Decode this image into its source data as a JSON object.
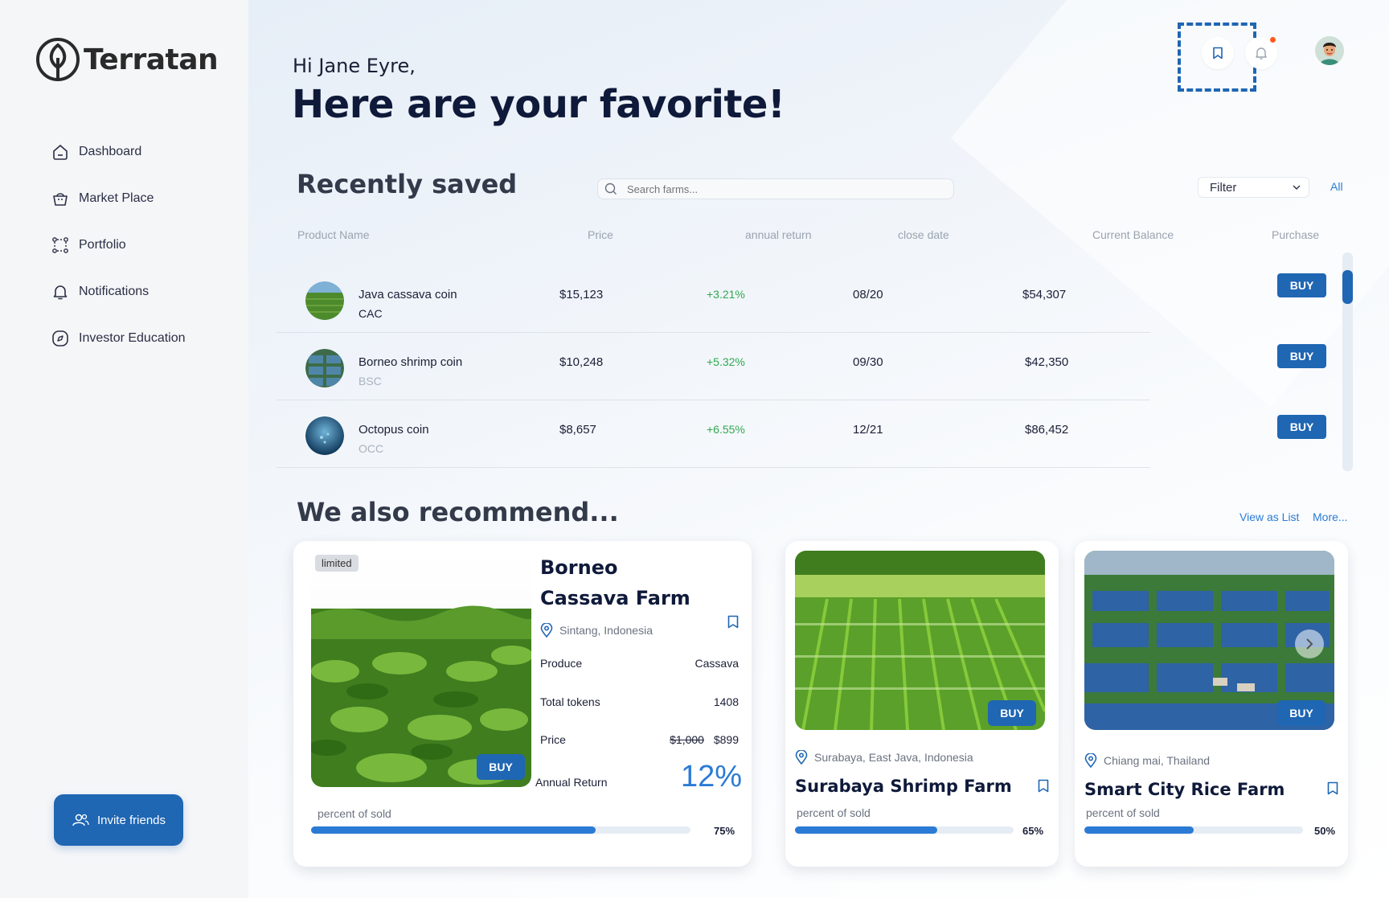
{
  "brand": {
    "name": "Terratan"
  },
  "sidebar": {
    "items": [
      {
        "label": "Dashboard",
        "icon": "home-icon"
      },
      {
        "label": "Market Place",
        "icon": "basket-icon"
      },
      {
        "label": "Portfolio",
        "icon": "portfolio-icon"
      },
      {
        "label": "Notifications",
        "icon": "bell-icon"
      },
      {
        "label": "Investor Education",
        "icon": "compass-icon"
      }
    ],
    "invite_label": "Invite friends"
  },
  "header": {
    "greeting": "Hi Jane Eyre,",
    "title": "Here are your favorite!"
  },
  "saved": {
    "title": "Recently saved",
    "search_placeholder": "Search farms...",
    "filter_label": "Filter",
    "all_label": "All",
    "columns": [
      "Product Name",
      "Price",
      "annual return",
      "close date",
      "Current Balance",
      "Purchase"
    ],
    "rows": [
      {
        "name": "Java cassava coin",
        "symbol": "CAC",
        "price": "$15,123",
        "annual_return": "+3.21%",
        "close_date": "08/20",
        "balance": "$54,307",
        "action": "BUY"
      },
      {
        "name": "Borneo shrimp coin",
        "symbol": "BSC",
        "price": "$10,248",
        "annual_return": "+5.32%",
        "close_date": "09/30",
        "balance": "$42,350",
        "action": "BUY"
      },
      {
        "name": "Octopus coin",
        "symbol": "OCC",
        "price": "$8,657",
        "annual_return": "+6.55%",
        "close_date": "12/21",
        "balance": "$86,452",
        "action": "BUY"
      }
    ]
  },
  "recommend": {
    "title": "We also recommend...",
    "view_as_list": "View as List",
    "more": "More...",
    "featured": {
      "badge": "limited",
      "title_line1": "Borneo",
      "title_line2": "Cassava Farm",
      "location": "Sintang, Indonesia",
      "produce_label": "Produce",
      "produce_value": "Cassava",
      "tokens_label": "Total tokens",
      "tokens_value": "1408",
      "price_label": "Price",
      "price_old": "$1,000",
      "price_new": "$899",
      "return_label": "Annual Return",
      "return_value": "12%",
      "buy_label": "BUY",
      "sold_label": "percent of sold",
      "sold_percent": "75%",
      "sold_fraction": 0.75
    },
    "cards": [
      {
        "location": "Surabaya, East Java, Indonesia",
        "title": "Surabaya Shrimp Farm",
        "buy_label": "BUY",
        "sold_label": "percent of sold",
        "sold_percent": "65%",
        "sold_fraction": 0.65
      },
      {
        "location": "Chiang mai, Thailand",
        "title": "Smart City Rice Farm",
        "buy_label": "BUY",
        "sold_label": "percent of sold",
        "sold_percent": "50%",
        "sold_fraction": 0.5
      }
    ]
  },
  "colors": {
    "accent": "#1f66b3",
    "link": "#2b7bd5",
    "positive": "#2fa84f",
    "notification_dot": "#ff5a1f"
  }
}
